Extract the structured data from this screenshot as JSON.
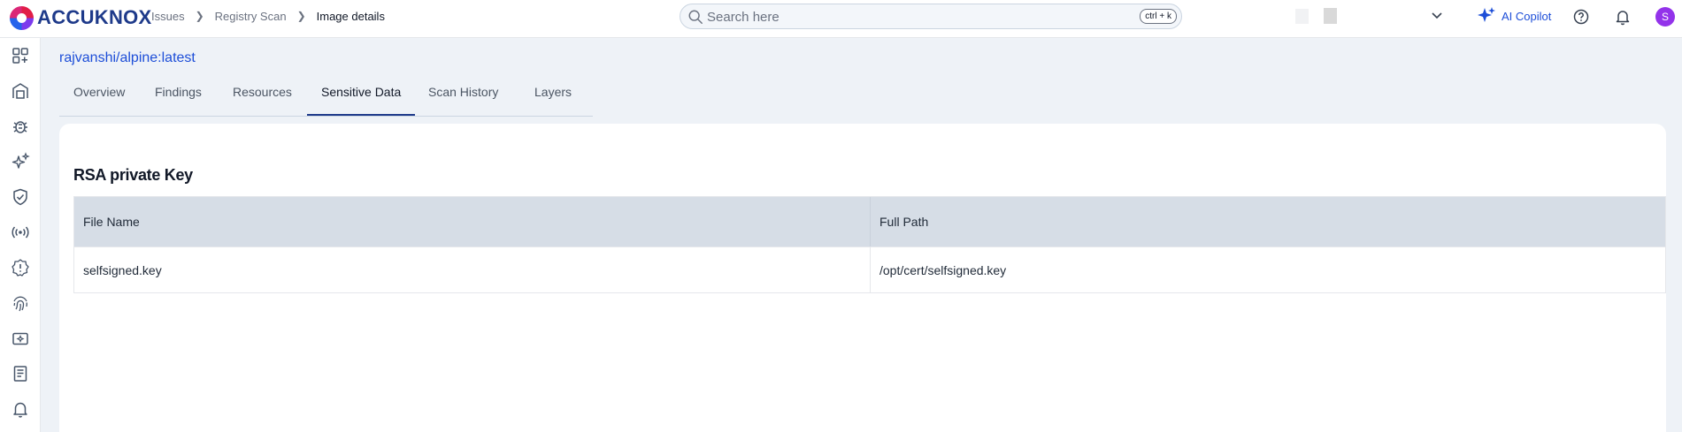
{
  "app": {
    "brand": "ACCUKNOX"
  },
  "breadcrumb": [
    "Issues",
    "Registry Scan",
    "Image details"
  ],
  "search": {
    "placeholder": "Search here",
    "shortcut": "ctrl + k"
  },
  "header_actions": {
    "copilot_label": "AI Copilot",
    "avatar_initial": "S"
  },
  "sidebar": {
    "icons": [
      "dashboard-icon",
      "inventory-icon",
      "issues-bug-icon",
      "sparkle-icon",
      "shield-check-icon",
      "broadcast-icon",
      "alert-badge-icon",
      "fingerprint-icon",
      "ticket-icon",
      "report-icon",
      "notification-bell-icon"
    ]
  },
  "page": {
    "image_name": "rajvanshi/alpine:latest",
    "tabs": [
      {
        "label": "Overview"
      },
      {
        "label": "Findings"
      },
      {
        "label": "Resources"
      },
      {
        "label": "Sensitive Data",
        "active": true
      },
      {
        "label": "Scan History"
      },
      {
        "label": "Layers"
      }
    ]
  },
  "sensitive_data": {
    "section_title": "RSA private Key",
    "columns": [
      "File Name",
      "Full Path"
    ],
    "rows": [
      [
        "selfsigned.key",
        "/opt/cert/selfsigned.key"
      ]
    ]
  },
  "colors": {
    "brand": "#1e3a8a",
    "link": "#1d4ed8",
    "header_row": "#d6dde6",
    "background": "#eef2f7",
    "avatar": "#9333ea"
  }
}
